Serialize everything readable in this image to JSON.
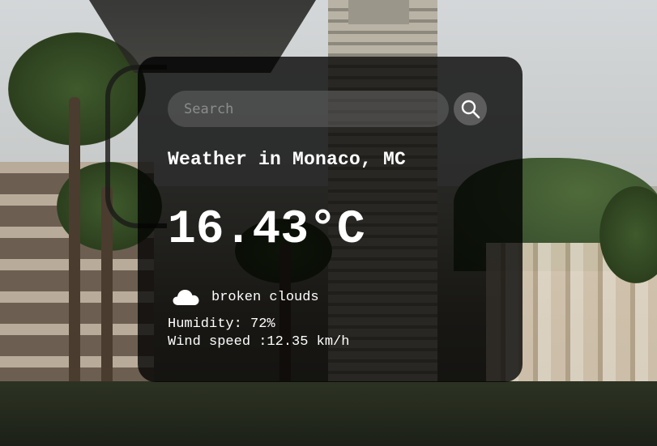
{
  "search": {
    "placeholder": "Search",
    "value": "",
    "button_icon": "search-icon"
  },
  "weather": {
    "title": "Weather in Monaco, MC",
    "temperature": "16.43°C",
    "description": "broken clouds",
    "description_icon": "cloud-icon",
    "humidity": "Humidity: 72%",
    "wind": "Wind speed :12.35 km/h"
  },
  "colors": {
    "card_background": "rgba(0,0,0,0.78)",
    "text": "#ffffff",
    "search_field": "#7d7d7d"
  }
}
